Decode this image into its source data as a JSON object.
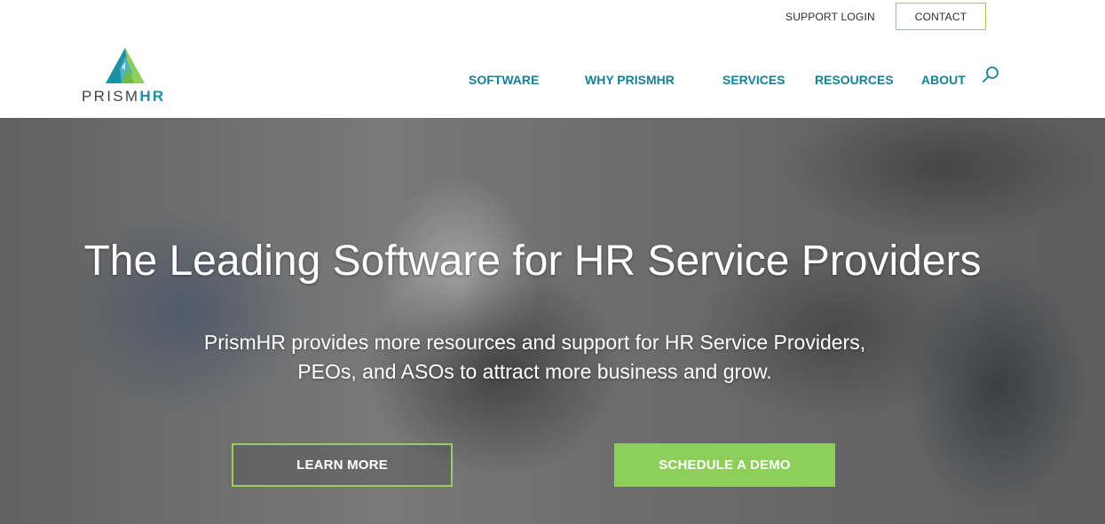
{
  "header": {
    "support_login_label": "SUPPORT LOGIN",
    "contact_label": "CONTACT",
    "logo": {
      "text_prism": "PRISM",
      "text_hr": "HR"
    },
    "nav": [
      {
        "label": "SOFTWARE"
      },
      {
        "label": "WHY PRISMHR"
      },
      {
        "label": "SERVICES"
      },
      {
        "label": "RESOURCES"
      },
      {
        "label": "ABOUT"
      }
    ],
    "search_icon": "search-icon"
  },
  "hero": {
    "title": "The Leading Software for HR Service Providers",
    "subtitle_line1": "PrismHR provides more resources and support for HR Service Providers,",
    "subtitle_line2": "PEOs, and ASOs to attract more business and grow.",
    "learn_more_label": "LEARN MORE",
    "schedule_demo_label": "SCHEDULE A DEMO"
  },
  "colors": {
    "brand_teal": "#15809a",
    "brand_green": "#8ccf5a",
    "brand_dark": "#3f4547",
    "outline_green": "#9acd5b"
  }
}
